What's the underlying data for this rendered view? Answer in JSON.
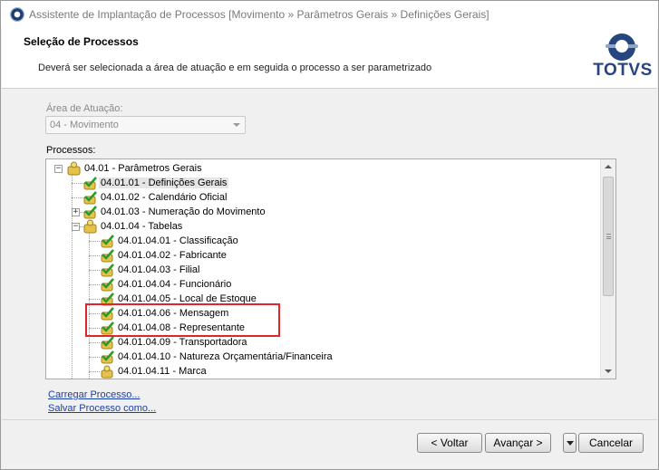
{
  "window": {
    "title": "Assistente de Implantação de Processos [Movimento » Parâmetros Gerais » Definições Gerais]"
  },
  "header": {
    "title": "Seleção de Processos",
    "description": "Deverá ser selecionada a área de atuação e em seguida o processo a ser parametrizado",
    "logo_text": "TOTVS"
  },
  "area": {
    "label": "Área de Atuação:",
    "selected": "04 - Movimento"
  },
  "processes": {
    "label": "Processos:",
    "nodes": [
      {
        "label": "04.01 - Parâmetros Gerais"
      },
      {
        "label": "04.01.01 - Definições Gerais"
      },
      {
        "label": "04.01.02 - Calendário Oficial"
      },
      {
        "label": "04.01.03 - Numeração do Movimento"
      },
      {
        "label": "04.01.04 - Tabelas"
      },
      {
        "label": "04.01.04.01 - Classificação"
      },
      {
        "label": "04.01.04.02 - Fabricante"
      },
      {
        "label": "04.01.04.03 - Filial"
      },
      {
        "label": "04.01.04.04 - Funcionário"
      },
      {
        "label": "04.01.04.05 - Local de Estoque"
      },
      {
        "label": "04.01.04.06 - Mensagem"
      },
      {
        "label": "04.01.04.08 - Representante"
      },
      {
        "label": "04.01.04.09 - Transportadora"
      },
      {
        "label": "04.01.04.10 - Natureza Orçamentária/Financeira"
      },
      {
        "label": "04.01.04.11 - Marca"
      }
    ]
  },
  "links": {
    "load": "Carregar Processo...",
    "save": "Salvar Processo como..."
  },
  "buttons": {
    "back": "< Voltar",
    "next": "Avançar >",
    "cancel": "Cancelar"
  },
  "colors": {
    "highlight": "#e0242b",
    "logo": "#26467d",
    "link": "#1a3fa6"
  }
}
